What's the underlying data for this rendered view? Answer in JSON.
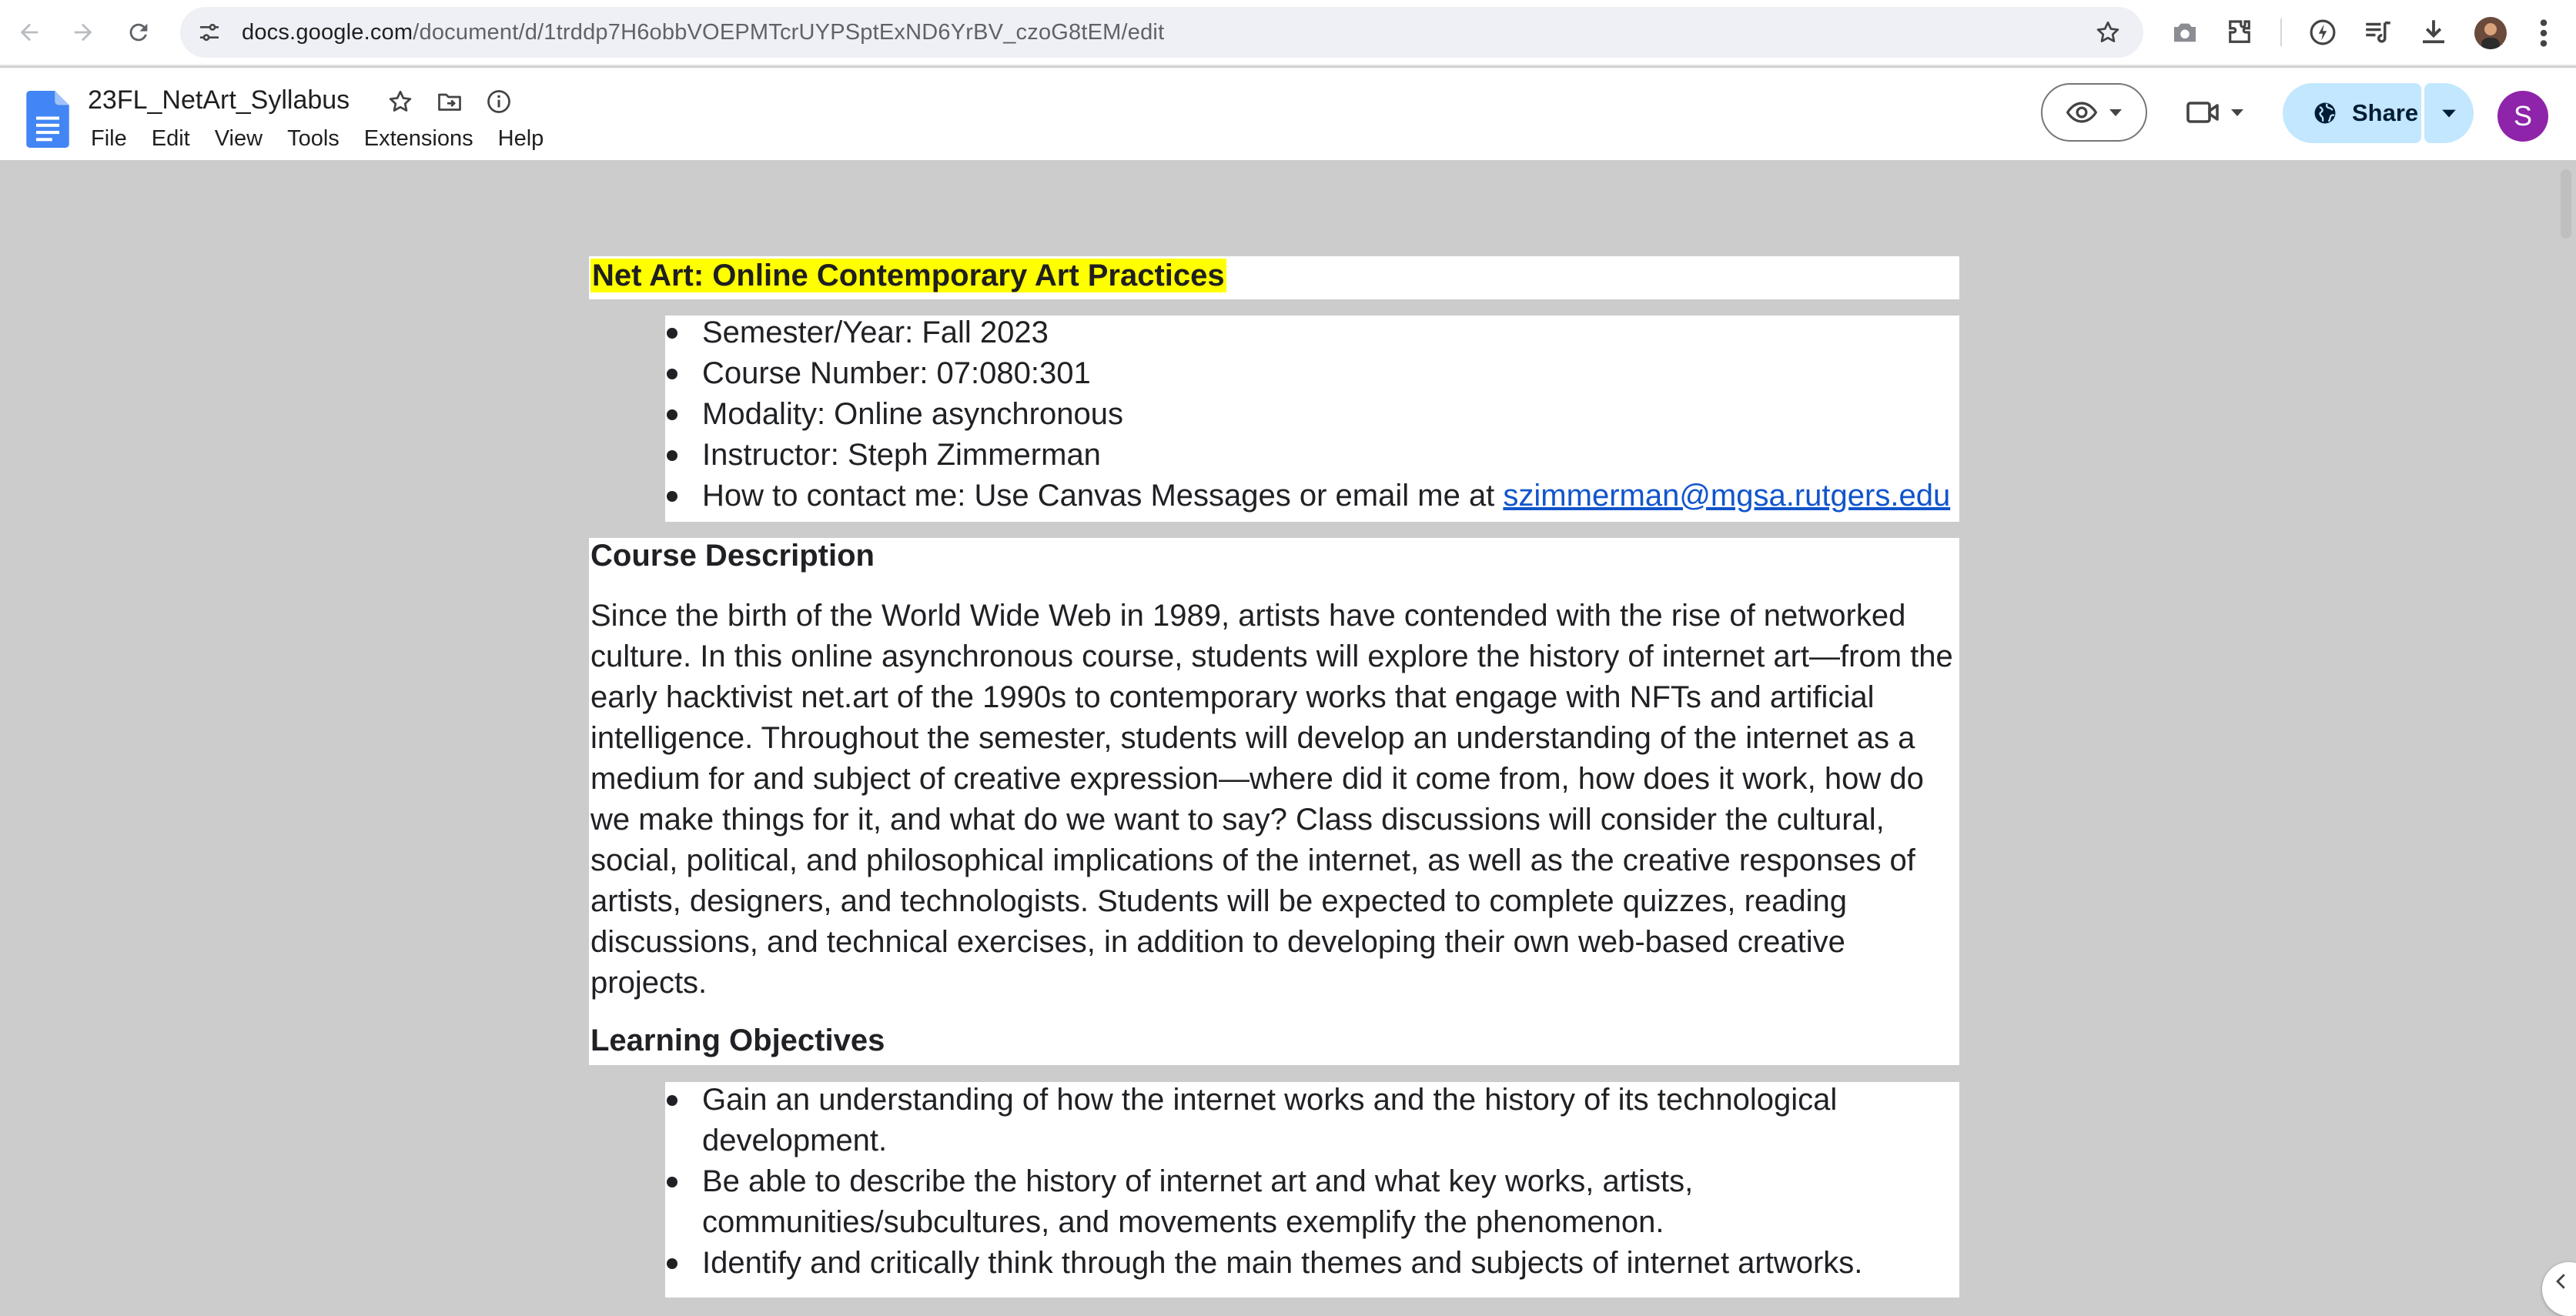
{
  "browser": {
    "url_host": "docs.google.com",
    "url_path": "/document/d/1trddp7H6obbVOEPMTcrUYPSptExND6YrBV_czoG8tEM/edit"
  },
  "docs": {
    "doc_title": "23FL_NetArt_Syllabus",
    "menu": [
      "File",
      "Edit",
      "View",
      "Tools",
      "Extensions",
      "Help"
    ],
    "share_label": "Share",
    "account_initial": "S"
  },
  "content": {
    "title": "Net Art: Online Contemporary Art Practices",
    "info": [
      "Semester/Year: Fall 2023",
      "Course Number: 07:080:301",
      "Modality: Online asynchronous",
      "Instructor: Steph Zimmerman"
    ],
    "contact_prefix": "How to contact me: Use Canvas Messages or email me at ",
    "contact_email": "szimmerman@mgsa.rutgers.edu",
    "desc_heading": "Course Description",
    "desc_lines": [
      "Since the birth of the World Wide Web in 1989, artists have contended with the rise of networked",
      "culture. In this online asynchronous course, students will explore the history of internet art—from the",
      "early hacktivist net.art of the 1990s to contemporary works that engage with NFTs and artificial",
      "intelligence. Throughout the semester, students will develop an understanding of the internet as a",
      "medium for and subject of creative expression—where did it come from, how does it work, how do",
      "we make things for it, and what do we want to say? Class discussions will consider the cultural,",
      "social, political, and philosophical implications of the internet, as well as the creative responses of",
      "artists, designers, and technologists. Students will be expected to complete quizzes, reading",
      "discussions, and technical exercises, in addition to developing their own web-based creative",
      "projects."
    ],
    "obj_heading": "Learning Objectives",
    "objectives": [
      {
        "line1": "Gain an understanding of how the internet works and the history of its technological",
        "line2": "development."
      },
      {
        "line1": "Be able to describe the history of internet art and what key works, artists,",
        "line2": "communities/subcultures, and movements exemplify the phenomenon."
      },
      {
        "line1": "Identify and critically think through the main themes and subjects of internet artworks.",
        "line2": ""
      }
    ]
  },
  "icons": {
    "back": "arrow-left-icon",
    "forward": "arrow-right-icon",
    "reload": "reload-icon",
    "site_info": "tune-icon",
    "bookmark": "star-icon",
    "camera": "camera-icon",
    "extensions": "puzzle-icon",
    "performance": "lightning-icon",
    "media": "media-playlist-icon",
    "download": "download-icon",
    "star": "star-outline-icon",
    "move": "folder-move-icon",
    "info": "info-icon",
    "eye": "eye-icon",
    "meet": "video-camera-icon",
    "globe": "globe-icon"
  },
  "colors": {
    "highlight": "#ffff00",
    "link": "#1155cc",
    "share_bg": "#c2e7ff",
    "docs_blue": "#4285f4",
    "avatar": "#8e24aa",
    "canvas": "#cccccc"
  }
}
